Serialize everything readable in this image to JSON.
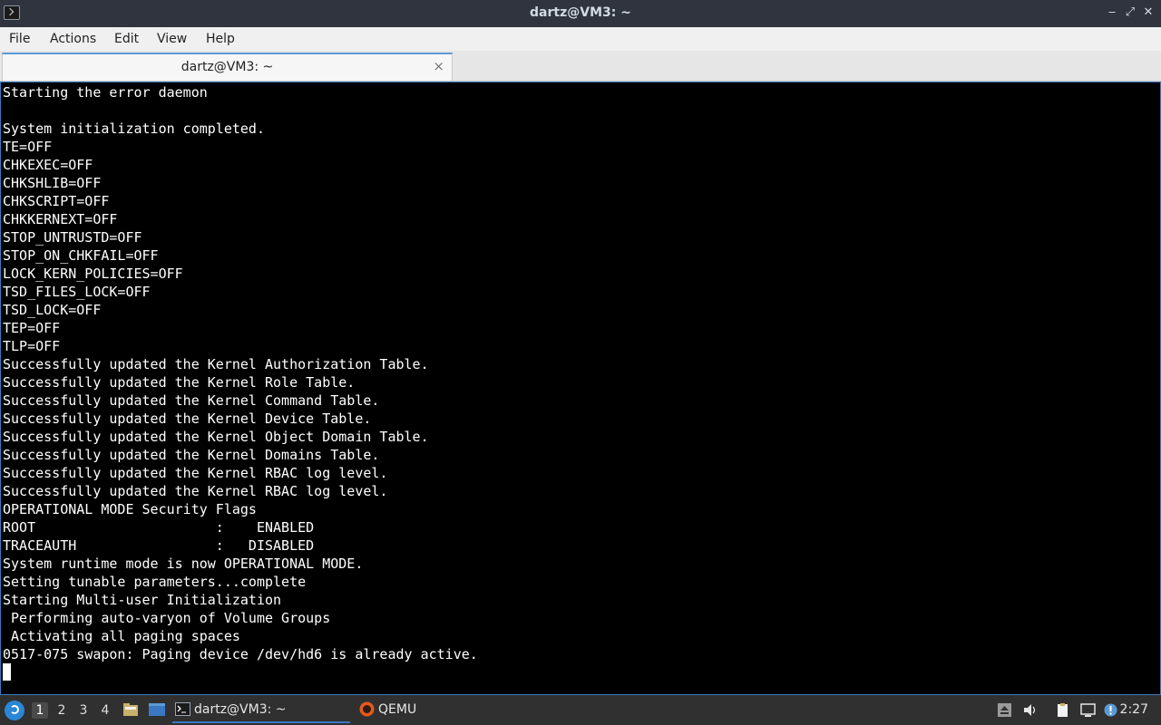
{
  "window": {
    "title": "dartz@VM3: ~",
    "controls": {
      "minimize": "‒",
      "maximize": "⤢",
      "close": "✕"
    }
  },
  "menu": [
    "File",
    "Actions",
    "Edit",
    "View",
    "Help"
  ],
  "tab": {
    "label": "dartz@VM3: ~",
    "close": "×"
  },
  "terminal": {
    "lines": [
      "Starting the error daemon",
      "",
      "System initialization completed.",
      "TE=OFF",
      "CHKEXEC=OFF",
      "CHKSHLIB=OFF",
      "CHKSCRIPT=OFF",
      "CHKKERNEXT=OFF",
      "STOP_UNTRUSTD=OFF",
      "STOP_ON_CHKFAIL=OFF",
      "LOCK_KERN_POLICIES=OFF",
      "TSD_FILES_LOCK=OFF",
      "TSD_LOCK=OFF",
      "TEP=OFF",
      "TLP=OFF",
      "Successfully updated the Kernel Authorization Table.",
      "Successfully updated the Kernel Role Table.",
      "Successfully updated the Kernel Command Table.",
      "Successfully updated the Kernel Device Table.",
      "Successfully updated the Kernel Object Domain Table.",
      "Successfully updated the Kernel Domains Table.",
      "Successfully updated the Kernel RBAC log level.",
      "Successfully updated the Kernel RBAC log level.",
      "OPERATIONAL MODE Security Flags",
      "ROOT                      :    ENABLED",
      "TRACEAUTH                 :   DISABLED",
      "System runtime mode is now OPERATIONAL MODE.",
      "Setting tunable parameters...complete",
      "Starting Multi-user Initialization",
      " Performing auto-varyon of Volume Groups",
      " Activating all paging spaces",
      "0517-075 swapon: Paging device /dev/hd6 is already active."
    ]
  },
  "taskbar": {
    "workspaces": [
      "1",
      "2",
      "3",
      "4"
    ],
    "tasks": [
      {
        "label": "dartz@VM3: ~",
        "icon": "terminal-icon"
      },
      {
        "label": "QEMU",
        "icon": "qemu-icon"
      }
    ],
    "clock": "2:27"
  },
  "colors": {
    "terminal_bg": "#000000",
    "terminal_fg": "#ffffff",
    "titlebar": "#2f343f",
    "accent": "#3b78c2",
    "taskbar": "#303030"
  }
}
